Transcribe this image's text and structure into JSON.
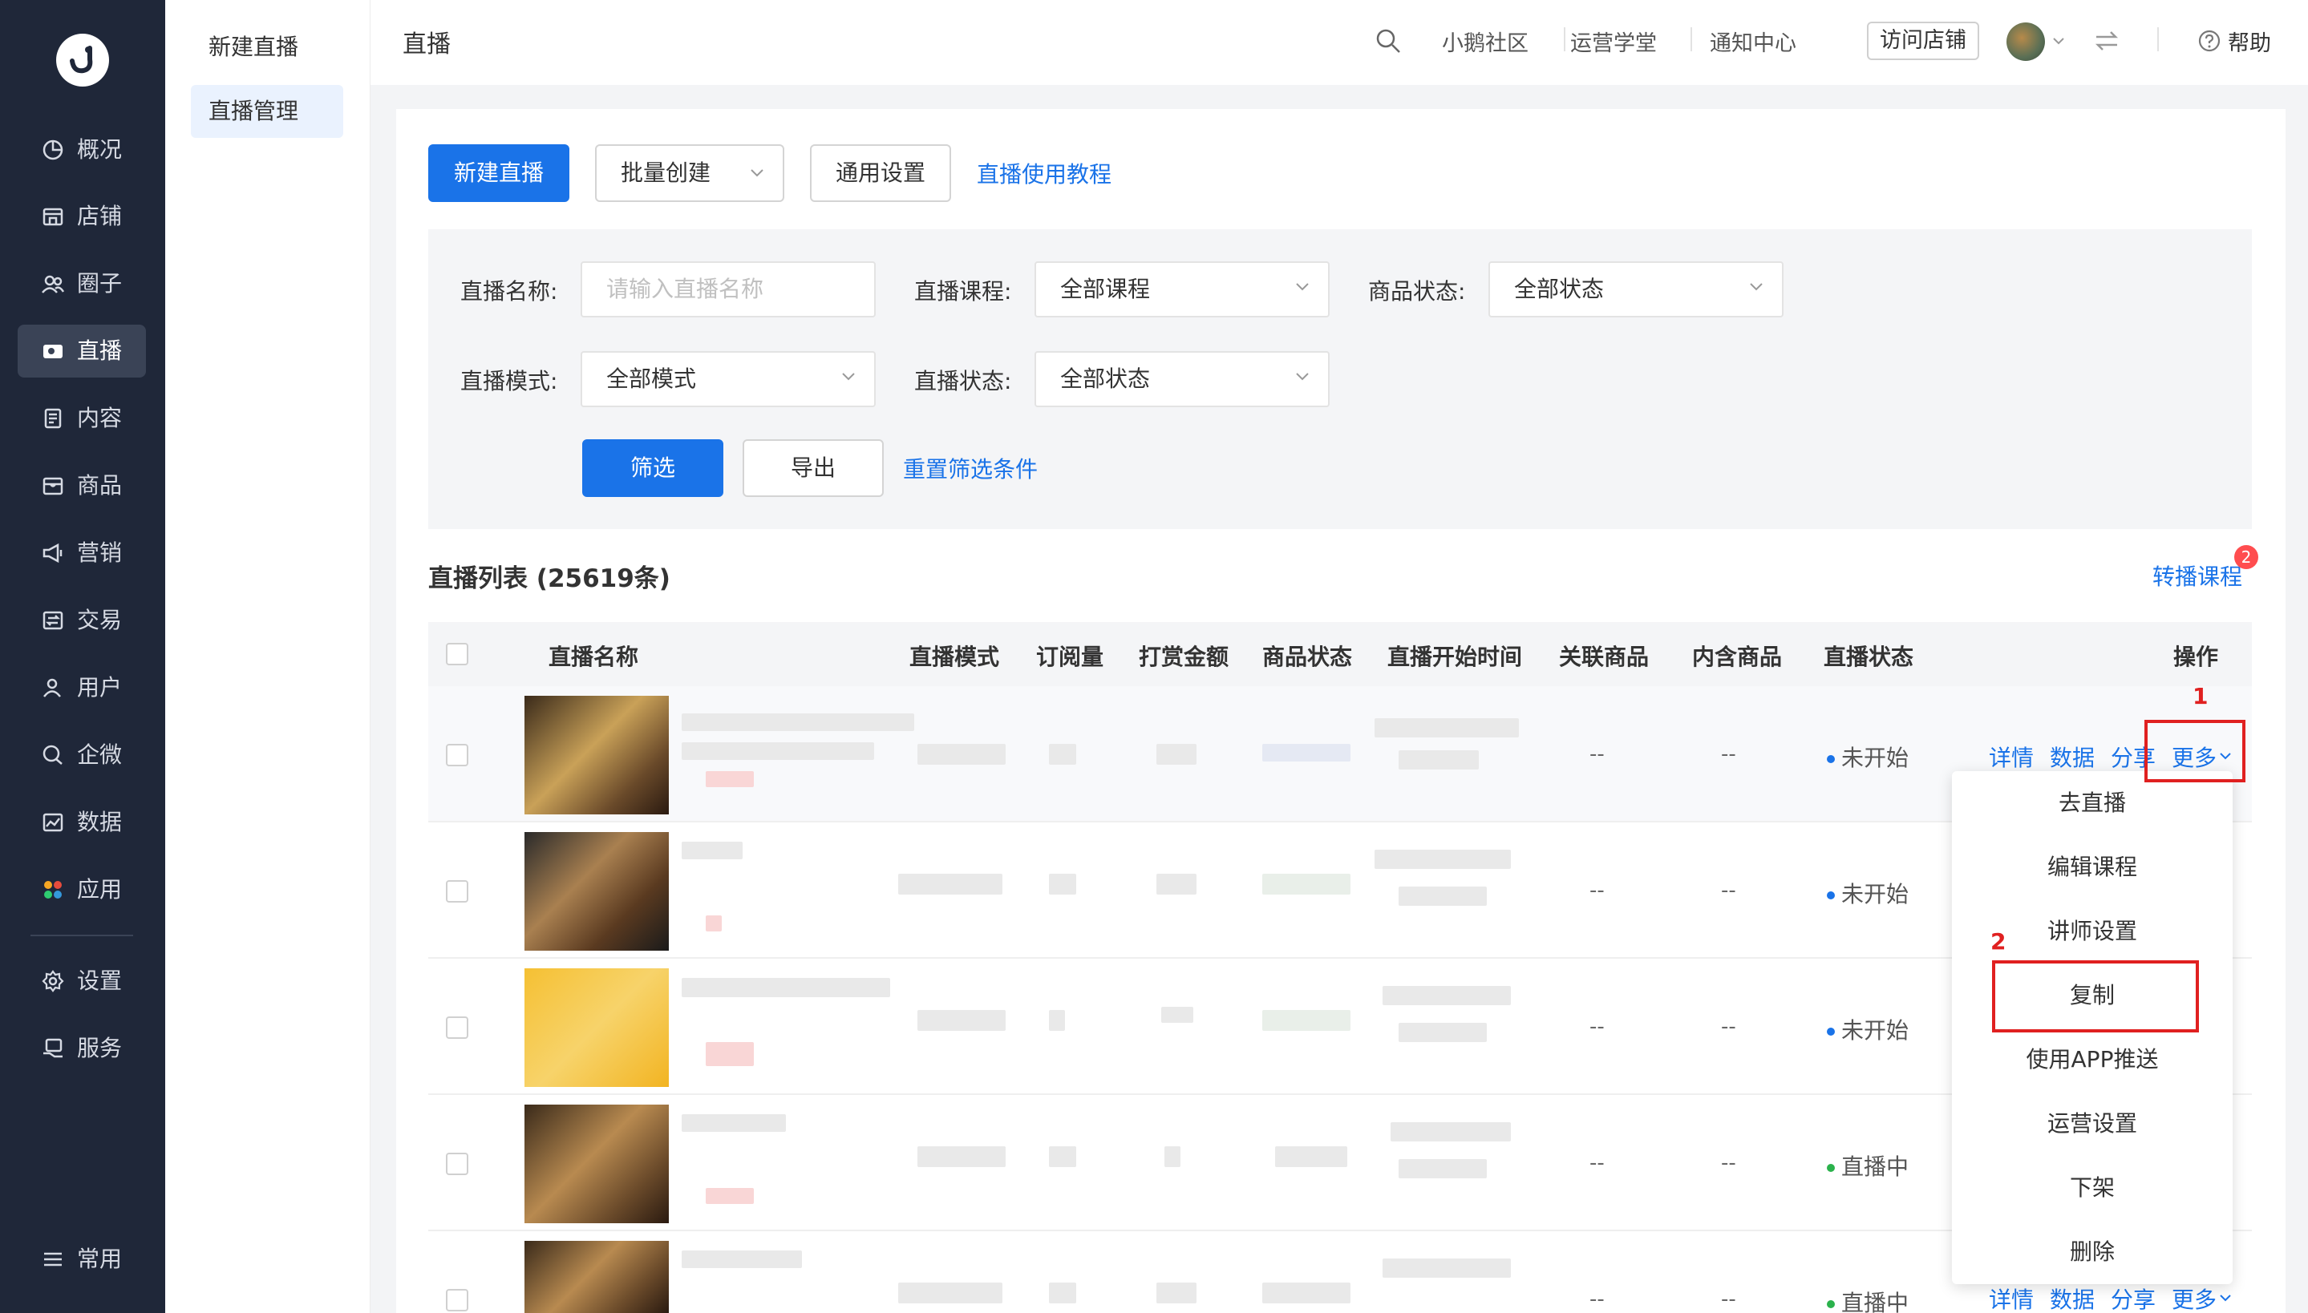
{
  "nav": {
    "items": [
      {
        "label": "概况",
        "icon": "pie-chart-icon"
      },
      {
        "label": "店铺",
        "icon": "store-icon"
      },
      {
        "label": "圈子",
        "icon": "group-icon"
      },
      {
        "label": "直播",
        "icon": "video-icon",
        "active": true
      },
      {
        "label": "内容",
        "icon": "document-icon"
      },
      {
        "label": "商品",
        "icon": "box-icon"
      },
      {
        "label": "营销",
        "icon": "megaphone-icon"
      },
      {
        "label": "交易",
        "icon": "exchange-icon"
      },
      {
        "label": "用户",
        "icon": "user-icon"
      },
      {
        "label": "企微",
        "icon": "wecom-icon"
      },
      {
        "label": "数据",
        "icon": "chart-icon"
      },
      {
        "label": "应用",
        "icon": "apps-icon"
      },
      {
        "label": "设置",
        "icon": "gear-icon"
      },
      {
        "label": "服务",
        "icon": "service-icon"
      }
    ],
    "common_label": "常用"
  },
  "submenu": {
    "items": [
      {
        "label": "新建直播"
      },
      {
        "label": "直播管理",
        "active": true
      }
    ]
  },
  "header": {
    "title": "直播",
    "links": [
      "小鹅社区",
      "运营学堂",
      "通知中心"
    ],
    "visit_store": "访问店铺",
    "help": "帮助"
  },
  "toolbar": {
    "new_live": "新建直播",
    "batch_create": "批量创建",
    "general_settings": "通用设置",
    "tutorial": "直播使用教程"
  },
  "filters": {
    "name_label": "直播名称:",
    "name_placeholder": "请输入直播名称",
    "course_label": "直播课程:",
    "course_value": "全部课程",
    "goods_label": "商品状态:",
    "goods_value": "全部状态",
    "mode_label": "直播模式:",
    "mode_value": "全部模式",
    "status_label": "直播状态:",
    "status_value": "全部状态",
    "filter_btn": "筛选",
    "export_btn": "导出",
    "reset": "重置筛选条件"
  },
  "list": {
    "title": "直播列表 (25619条)",
    "relay_course": "转播课程",
    "relay_badge": "2",
    "columns": [
      "直播名称",
      "直播模式",
      "订阅量",
      "打赏金额",
      "商品状态",
      "直播开始时间",
      "关联商品",
      "内含商品",
      "直播状态",
      "操作"
    ],
    "rows": [
      {
        "related": "--",
        "included": "--",
        "status": "未开始",
        "status_color": "#1a73e8"
      },
      {
        "related": "--",
        "included": "--",
        "status": "未开始",
        "status_color": "#1a73e8"
      },
      {
        "related": "--",
        "included": "--",
        "status": "未开始",
        "status_color": "#1a73e8"
      },
      {
        "related": "--",
        "included": "--",
        "status": "直播中",
        "status_color": "#2bb24c"
      },
      {
        "related": "--",
        "included": "--",
        "status": "直播中",
        "status_color": "#2bb24c"
      }
    ],
    "ops": {
      "detail": "详情",
      "data": "数据",
      "share": "分享",
      "more": "更多"
    }
  },
  "dropdown": {
    "items": [
      "去直播",
      "编辑课程",
      "讲师设置",
      "复制",
      "使用APP推送",
      "运营设置",
      "下架",
      "删除"
    ]
  },
  "annotations": {
    "step1": "1",
    "step2": "2"
  },
  "colors": {
    "primary": "#1a73e8",
    "nav_bg": "#1f2739",
    "annotation": "#e02020"
  }
}
